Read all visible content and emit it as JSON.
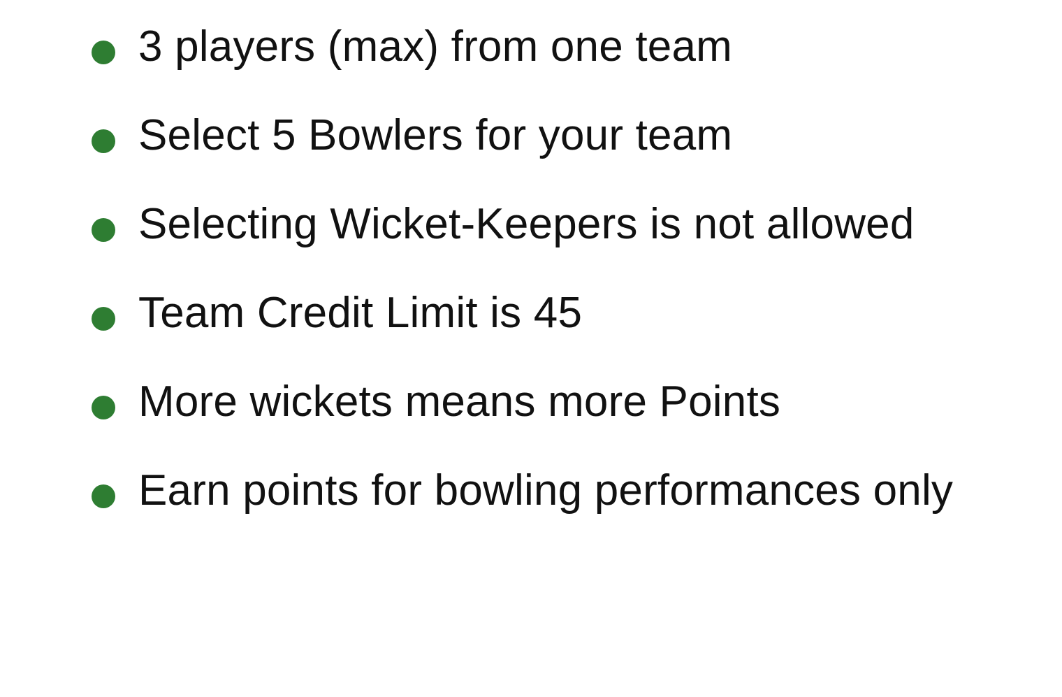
{
  "rules": {
    "bullet_color": "#2e7d32",
    "items": [
      {
        "text": "3 players (max) from one team"
      },
      {
        "text": "Select 5 Bowlers for your team"
      },
      {
        "text": "Selecting Wicket-Keepers is not allowed"
      },
      {
        "text": "Team Credit Limit is 45"
      },
      {
        "text": "More wickets means more Points"
      },
      {
        "text": "Earn points for bowling performances only"
      }
    ]
  }
}
